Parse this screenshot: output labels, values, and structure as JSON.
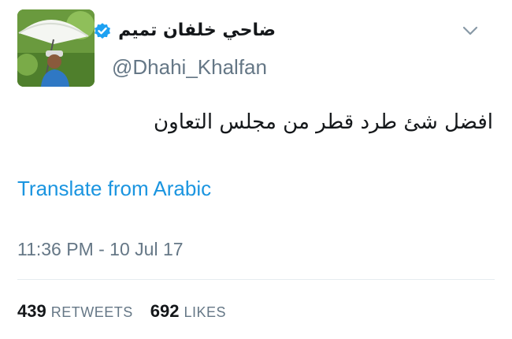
{
  "author": {
    "display_name": "ضاحي خلفان تميم",
    "handle": "@Dhahi_Khalfan",
    "verified": true
  },
  "tweet": {
    "text": "افضل شئ طرد قطر من مجلس التعاون",
    "translate_label": "Translate from Arabic",
    "timestamp": "11:36 PM - 10 Jul 17"
  },
  "stats": {
    "retweets_count": "439",
    "retweets_label": "RETWEETS",
    "likes_count": "692",
    "likes_label": "LIKES"
  },
  "icons": {
    "verified": "verified-badge-icon",
    "menu": "chevron-down-icon"
  },
  "colors": {
    "link": "#1b95e0",
    "verified": "#1da1f2",
    "secondary_text": "#657786",
    "primary_text": "#14171a"
  }
}
